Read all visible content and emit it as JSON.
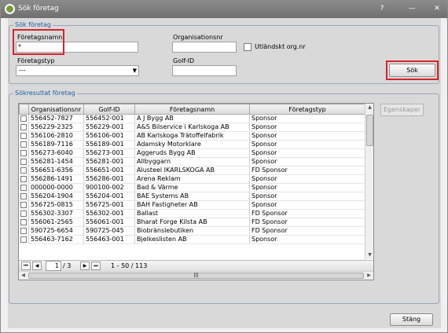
{
  "window": {
    "title": "Sök företag",
    "help_glyph": "?",
    "minimize_glyph": "—",
    "close_glyph": "✕"
  },
  "search": {
    "group_title": "Sök företag",
    "company_name_label": "Företagsnamn",
    "company_name_value": "*",
    "org_nr_label": "Organisationsnr",
    "org_nr_value": "",
    "foreign_org_label": "Utländskt org.nr",
    "company_type_label": "Företagstyp",
    "company_type_value": "---",
    "golf_id_label": "Golf-ID",
    "golf_id_value": "",
    "search_button": "Sök"
  },
  "results": {
    "group_title": "Sökresultat företag",
    "properties_button": "Egenskaper",
    "columns": [
      "Organisationsnr",
      "Golf-ID",
      "Företagsnamn",
      "Företagstyp"
    ],
    "rows": [
      [
        "556452-7827",
        "556452-001",
        "A J Bygg AB",
        "Sponsor"
      ],
      [
        "556229-2325",
        "556229-001",
        "A&S Bilservice i Karlskoga AB",
        "Sponsor"
      ],
      [
        "556106-2810",
        "556106-001",
        "AB Karlskoga Trätoffelfabrik",
        "Sponsor"
      ],
      [
        "556189-7116",
        "556189-001",
        "Adamsky Motorklare",
        "Sponsor"
      ],
      [
        "556273-6040",
        "556273-001",
        "Aggeruds Bygg AB",
        "Sponsor"
      ],
      [
        "556281-1454",
        "556281-001",
        "Allbyggarn",
        "Sponsor"
      ],
      [
        "556651-6356",
        "556651-001",
        "Alusteel IKARLSKOGA AB",
        "FD Sponsor"
      ],
      [
        "556286-1491",
        "556286-001",
        "Arena Reklam",
        "Sponsor"
      ],
      [
        "000000-0000",
        "900100-002",
        "Bad & Värme",
        "Sponsor"
      ],
      [
        "556204-1904",
        "556204-001",
        "BAE Systems AB",
        "Sponsor"
      ],
      [
        "556725-0815",
        "556725-001",
        "BAH Fastigheter AB",
        "Sponsor"
      ],
      [
        "556302-3307",
        "556302-001",
        "Ballast",
        "FD Sponsor"
      ],
      [
        "556061-2565",
        "556061-001",
        "Bharat Forge Kilsta AB",
        "FD Sponsor"
      ],
      [
        "590725-6654",
        "590725-045",
        "Biobränslebutiken",
        "FD Sponsor"
      ],
      [
        "556463-7162",
        "556463-001",
        "Bjelkeslisten AB",
        "Sponsor"
      ]
    ],
    "pager": {
      "first_glyph": "⏮",
      "prev_glyph": "◀",
      "next_glyph": "▶",
      "last_glyph": "⏭",
      "page_value": "1",
      "page_total": "/ 3",
      "range": "1 - 50 / 113"
    }
  },
  "footer": {
    "close_button": "Stäng"
  }
}
